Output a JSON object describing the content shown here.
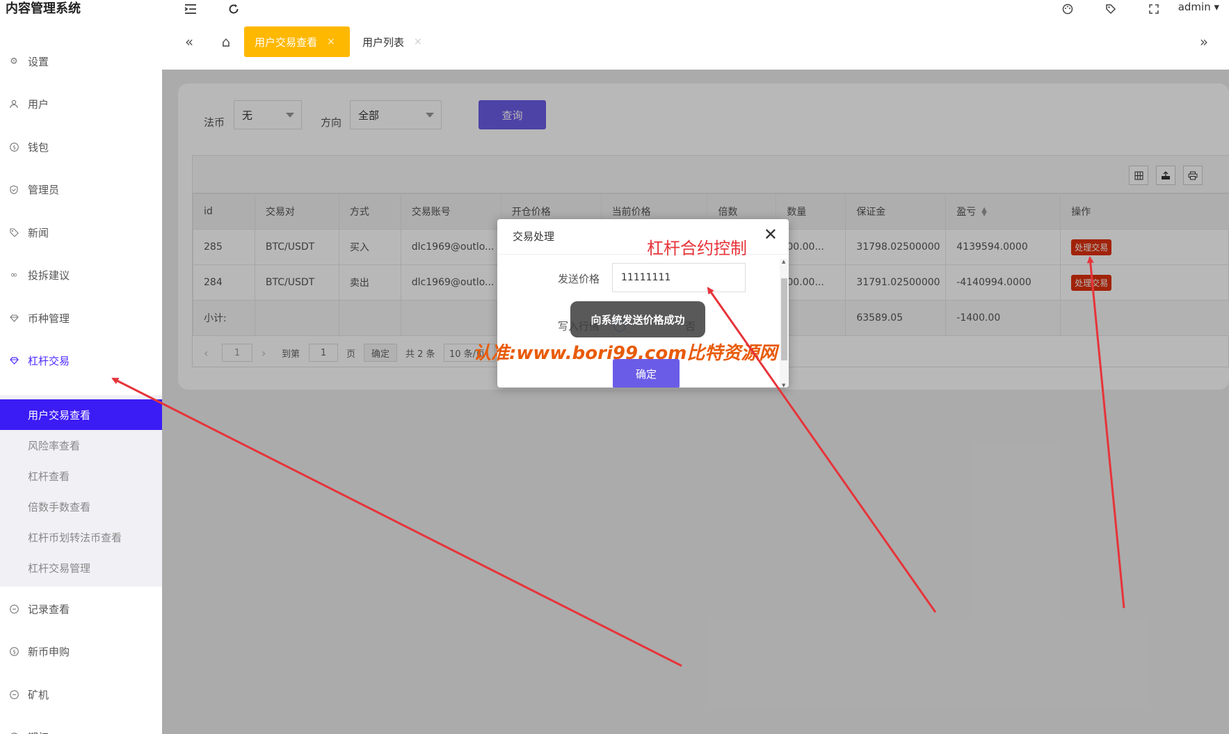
{
  "app": {
    "title": "内容管理系统",
    "user": "admin ▾"
  },
  "header": {
    "icons": [
      "menu-fold-icon",
      "refresh-icon",
      "palette-icon",
      "tag-icon",
      "fullscreen-icon"
    ]
  },
  "sidebar": {
    "items": [
      {
        "label": "设置",
        "icon": "gear-icon"
      },
      {
        "label": "用户",
        "icon": "user-icon"
      },
      {
        "label": "钱包",
        "icon": "dollar-icon"
      },
      {
        "label": "管理员",
        "icon": "shield-icon"
      },
      {
        "label": "新闻",
        "icon": "tag-icon"
      },
      {
        "label": "投拆建议",
        "icon": "link-icon"
      },
      {
        "label": "币种管理",
        "icon": "diamond-icon"
      },
      {
        "label": "杠杆交易",
        "icon": "diamond-icon"
      },
      {
        "label": "记录查看",
        "icon": "circle-icon"
      },
      {
        "label": "新币申购",
        "icon": "dollar-icon"
      },
      {
        "label": "矿机",
        "icon": "circle-icon"
      },
      {
        "label": "期权",
        "icon": "circle-icon"
      }
    ],
    "submenu": [
      "用户交易查看",
      "风险率查看",
      "杠杆查看",
      "倍数手数查看",
      "杠杆币划转法币查看",
      "杠杆交易管理"
    ]
  },
  "tabs": {
    "active": {
      "label": "用户交易查看",
      "close": "×"
    },
    "other": {
      "label": "用户列表",
      "close": "×"
    },
    "prev": "«",
    "next": "»",
    "home": "⌂"
  },
  "filters": {
    "currency_label": "法币",
    "currency_value": "无",
    "direction_label": "方向",
    "direction_value": "全部",
    "query_button": "查询"
  },
  "table": {
    "columns": [
      "id",
      "交易对",
      "方式",
      "交易账号",
      "开仓价格",
      "当前价格",
      "倍数",
      "数量",
      "保证金",
      "盈亏",
      "操作"
    ],
    "rows": [
      {
        "id": "285",
        "pair": "BTC/USDT",
        "side": "买入",
        "account": "dlc1969@outlo...",
        "open": "",
        "current": "",
        "mult": "",
        "qty": "00.00...",
        "margin": "31798.02500000",
        "pnl": "4139594.0000",
        "op": "处理交易"
      },
      {
        "id": "284",
        "pair": "BTC/USDT",
        "side": "卖出",
        "account": "dlc1969@outlo...",
        "open": "",
        "current": "",
        "mult": "",
        "qty": "00.00...",
        "margin": "31791.02500000",
        "pnl": "-4140994.0000",
        "op": "处理交易"
      }
    ],
    "subtotal": {
      "label": "小计:",
      "margin": "63589.05",
      "pnl": "-1400.00"
    }
  },
  "pager": {
    "current": "1",
    "goto_label": "到第",
    "goto_value": "1",
    "page_label": "页",
    "confirm": "确定",
    "total": "共 2 条",
    "per_page": "10 条/页"
  },
  "modal": {
    "title": "交易处理",
    "close": "✕",
    "price_label": "发送价格",
    "price_value": "11111111",
    "write_label": "写入行情",
    "no_label": "否",
    "ok": "确定"
  },
  "toast": "向系统发送价格成功",
  "annotations": {
    "note": "杠杆合约控制",
    "watermark": "认准:www.bori99.com比特资源网",
    "arrow_color": "#e6343a"
  },
  "colors": {
    "accent": "#3b1cf5",
    "tab_active": "#ffb800",
    "primary_button": "#6b5ce7",
    "danger": "#e0310d"
  }
}
